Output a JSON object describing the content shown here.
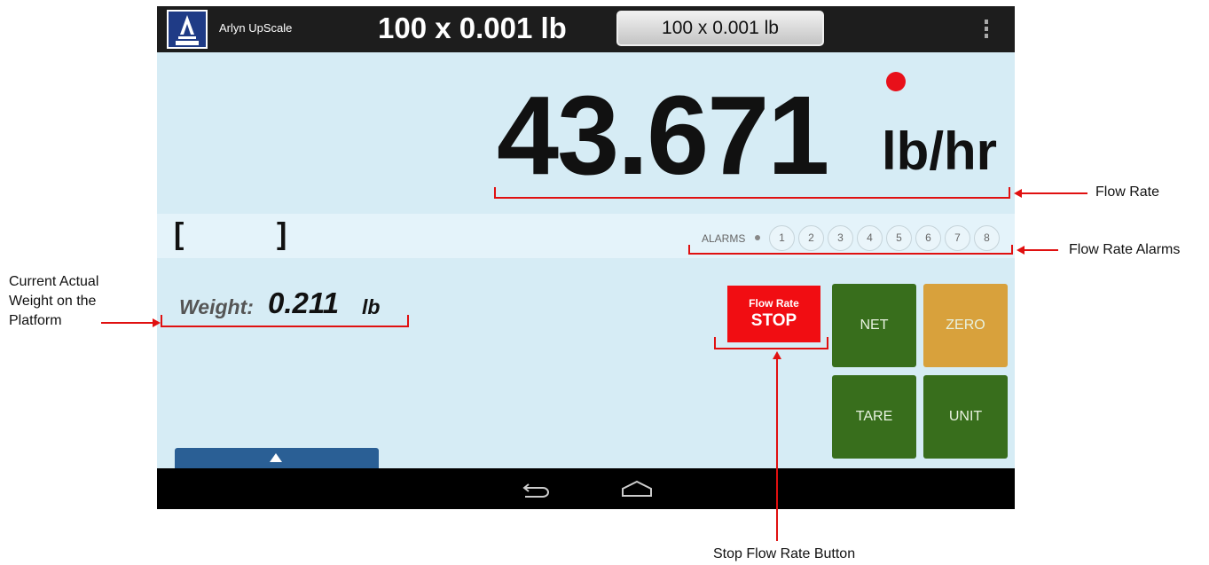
{
  "app": {
    "title": "Arlyn UpScale",
    "capacity_display": "100 x 0.001 lb",
    "capacity_button": "100 x 0.001 lb",
    "menu_icon": "overflow-menu-icon",
    "logo_icon": "arlyn-logo-icon"
  },
  "flow": {
    "value": "43.671",
    "unit": "lb/hr",
    "indicator_color": "#e8101a"
  },
  "bracket": {
    "left": "[",
    "right": "]"
  },
  "alarms": {
    "label": "ALARMS",
    "items": [
      "1",
      "2",
      "3",
      "4",
      "5",
      "6",
      "7",
      "8"
    ]
  },
  "weight": {
    "label": "Weight:",
    "value": "0.211",
    "unit": "lb"
  },
  "buttons": {
    "stop_top": "Flow Rate",
    "stop_main": "STOP",
    "net": "NET",
    "zero": "ZERO",
    "tare": "TARE",
    "unit": "UNIT"
  },
  "nav": {
    "back_icon": "back-icon",
    "home_icon": "home-icon"
  },
  "annotations": {
    "flow_rate": "Flow Rate",
    "flow_rate_alarms": "Flow Rate Alarms",
    "current_weight": [
      "Current Actual",
      "Weight on the",
      "Platform"
    ],
    "stop_button": "Stop Flow Rate Button"
  },
  "colors": {
    "screen_bg": "#d6ecf5",
    "top_bar": "#1d1d1d",
    "stop_red": "#f10d12",
    "green_button": "#386e1c",
    "zero_orange": "#d8a13c",
    "annotation_red": "#e01010"
  }
}
